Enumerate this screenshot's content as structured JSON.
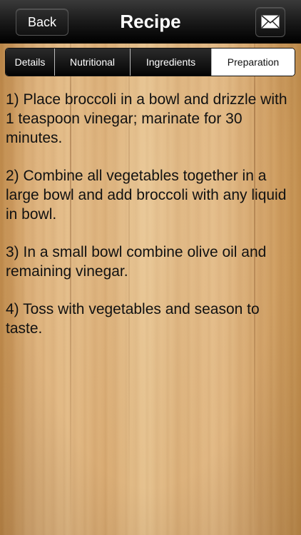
{
  "navbar": {
    "back_label": "Back",
    "title": "Recipe",
    "mail_icon": "envelope-icon"
  },
  "tabs": [
    {
      "label": "Details",
      "active": false
    },
    {
      "label": "Nutritional",
      "active": false
    },
    {
      "label": "Ingredients",
      "active": false
    },
    {
      "label": "Preparation",
      "active": true
    }
  ],
  "steps": [
    "1) Place broccoli in a bowl and drizzle with 1 teaspoon vinegar; marinate for 30 minutes.",
    "2) Combine all vegetables together in a large bowl and add broccoli with any liquid in bowl.",
    "3) In a small bowl combine olive oil and remaining vinegar.",
    "4) Toss with vegetables and season to taste."
  ],
  "colors": {
    "navbar": "#000000",
    "wood": "#dcb07a",
    "active_tab": "#ffffff"
  }
}
